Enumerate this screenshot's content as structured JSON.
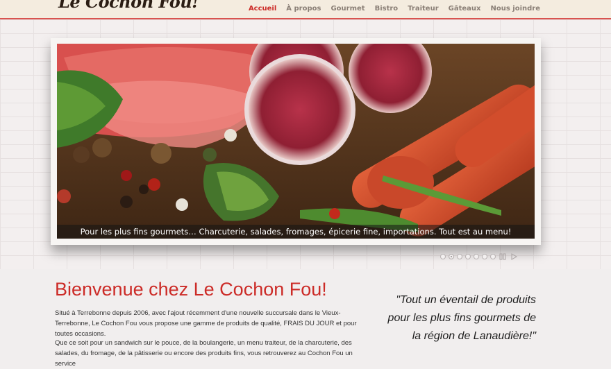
{
  "header": {
    "logo_text": "Le Cochon Fou!",
    "nav": [
      {
        "label": "Accueil",
        "active": true
      },
      {
        "label": "À propos"
      },
      {
        "label": "Gourmet"
      },
      {
        "label": "Bistro"
      },
      {
        "label": "Traiteur"
      },
      {
        "label": "Gâteaux"
      },
      {
        "label": "Nous joindre"
      }
    ]
  },
  "slider": {
    "caption": "Pour les plus fins gourmets… Charcuterie, salades, fromages, épicerie fine, importations. Tout est au menu!",
    "slide_count": 7,
    "active_index": 1,
    "pause_icon": "pause-icon",
    "next_icon": "play-icon"
  },
  "main": {
    "title": "Bienvenue chez Le Cochon Fou!",
    "paragraph1": "Situé à Terrebonne depuis 2006, avec l'ajout récemment d'une nouvelle succursale dans le Vieux-Terrebonne, Le Cochon Fou vous propose une gamme de produits de qualité, FRAIS DU JOUR et pour toutes occasions.",
    "paragraph2": "Que ce soit pour un sandwich sur le pouce, de la boulangerie, un menu traiteur, de la charcuterie, des salades, du fromage, de la pâtisserie ou encore des produits fins, vous retrouverez au Cochon Fou un service"
  },
  "quote": "\"Tout un éventail de produits pour les plus fins gourmets de la région de Lanaudière!\"",
  "colors": {
    "accent": "#cc2b27",
    "header_bg": "#f4ecdf"
  }
}
